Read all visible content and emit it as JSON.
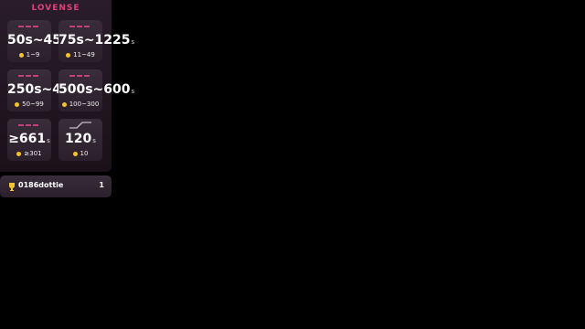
{
  "brand": "LOVENSE",
  "levels": [
    {
      "duration": "50s~450",
      "unit": "s",
      "tokens": "1~9"
    },
    {
      "duration": "75s~1225",
      "unit": "s",
      "tokens": "11~49"
    },
    {
      "duration": "250s~490",
      "unit": "s",
      "tokens": "50~99"
    },
    {
      "duration": "500s~600",
      "unit": "s",
      "tokens": "100~300"
    },
    {
      "duration": "≥661",
      "unit": "s",
      "tokens": "≥301"
    },
    {
      "duration": "120",
      "unit": "s",
      "tokens": "10"
    }
  ],
  "leaderboard": {
    "name": "0186dottie",
    "count": "1"
  },
  "colors": {
    "accent": "#e0407a",
    "coin": "#f4c430",
    "background": "#000000"
  }
}
